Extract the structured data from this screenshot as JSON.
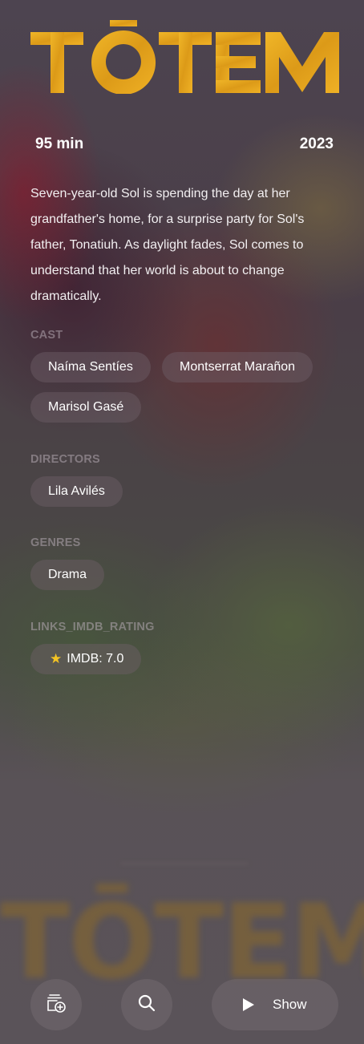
{
  "movie": {
    "title": "TŌTEM",
    "runtime": "95 min",
    "year": "2023",
    "overview": "Seven-year-old Sol is spending the day at her grandfather's home, for a surprise party for Sol's father, Tonatiuh. As daylight fades, Sol comes to understand that her world is about to change dramatically."
  },
  "sections": {
    "cast_label": "CAST",
    "directors_label": "DIRECTORS",
    "genres_label": "GENRES",
    "rating_label": "LINKS_IMDB_RATING"
  },
  "cast": [
    "Naíma Sentíes",
    "Montserrat Marañon",
    "Marisol Gasé"
  ],
  "directors": [
    "Lila Avilés"
  ],
  "genres": [
    "Drama"
  ],
  "rating": {
    "text": "IMDB: 7.0",
    "icon": "star-icon"
  },
  "actions": {
    "watchlist_icon": "add-to-watchlist-icon",
    "search_icon": "search-icon",
    "show_label": "Show",
    "play_icon": "play-icon"
  },
  "colors": {
    "logo_gold": "#e8a21c",
    "star": "#f3c323",
    "chip_bg": "#6e5f69"
  }
}
